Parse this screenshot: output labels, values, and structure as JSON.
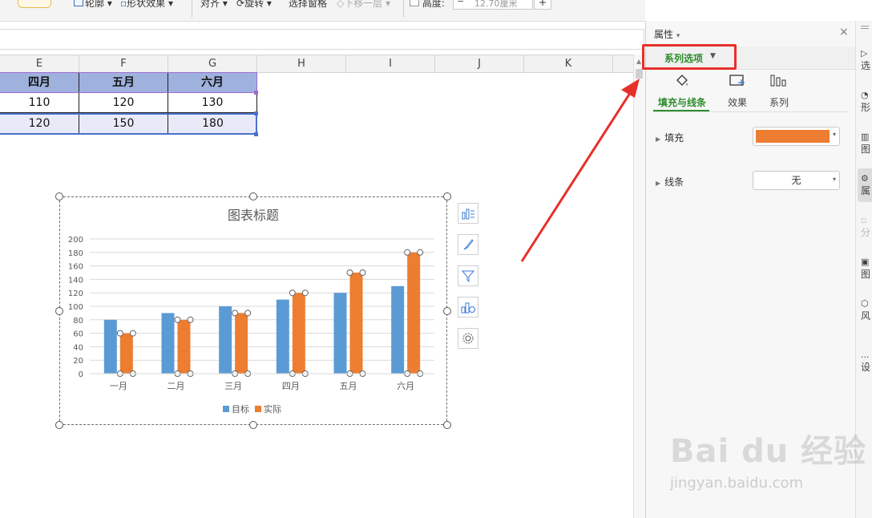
{
  "ribbon": {
    "outline_label": "轮廓",
    "shape_effect_label": "形状效果",
    "align_label": "对齐",
    "rotate_label": "旋转",
    "select_pane_label": "选择窗格",
    "move_down_label": "下移一层",
    "height_label": "高度:",
    "height_value": "12.70厘米",
    "minus": "−",
    "plus": "+"
  },
  "sheet": {
    "columns": [
      "E",
      "F",
      "G",
      "H",
      "I",
      "J",
      "K"
    ],
    "header_row": [
      "四月",
      "五月",
      "六月"
    ],
    "row1": [
      "110",
      "120",
      "130"
    ],
    "row2": [
      "120",
      "150",
      "180"
    ]
  },
  "chart_data": {
    "type": "bar",
    "title": "图表标题",
    "categories": [
      "一月",
      "二月",
      "三月",
      "四月",
      "五月",
      "六月"
    ],
    "series": [
      {
        "name": "目标",
        "values": [
          80,
          90,
          100,
          110,
          120,
          130
        ],
        "color": "#5b9bd5"
      },
      {
        "name": "实际",
        "values": [
          60,
          80,
          90,
          120,
          150,
          180
        ],
        "color": "#ed7d31"
      }
    ],
    "ylim": [
      0,
      200
    ],
    "yticks": [
      0,
      20,
      40,
      60,
      80,
      100,
      120,
      140,
      160,
      180,
      200
    ],
    "grid": true,
    "legend": "bottom",
    "selected_series": "实际"
  },
  "chart_tools": [
    "chart-elements-icon",
    "chart-style-icon",
    "chart-filter-icon",
    "chart-settings-icon",
    "chart-gear-icon"
  ],
  "panel": {
    "title": "属性",
    "title_arrow": "▾",
    "close": "×",
    "series_options_label": "系列选项",
    "series_options_arrow": "▼",
    "subtabs": [
      "填充与线条",
      "效果",
      "系列"
    ],
    "fill_label": "填充",
    "fill_color": "#ed7d31",
    "line_label": "线条",
    "line_value": "无",
    "caret": "▾",
    "tri": "▶"
  },
  "strip": {
    "items": [
      "选",
      "形",
      "图",
      "属",
      "分",
      "图",
      "风",
      "设"
    ],
    "dots": "..."
  },
  "watermark": {
    "brand": "Bai du 经验",
    "url": "jingyan.baidu.com"
  }
}
